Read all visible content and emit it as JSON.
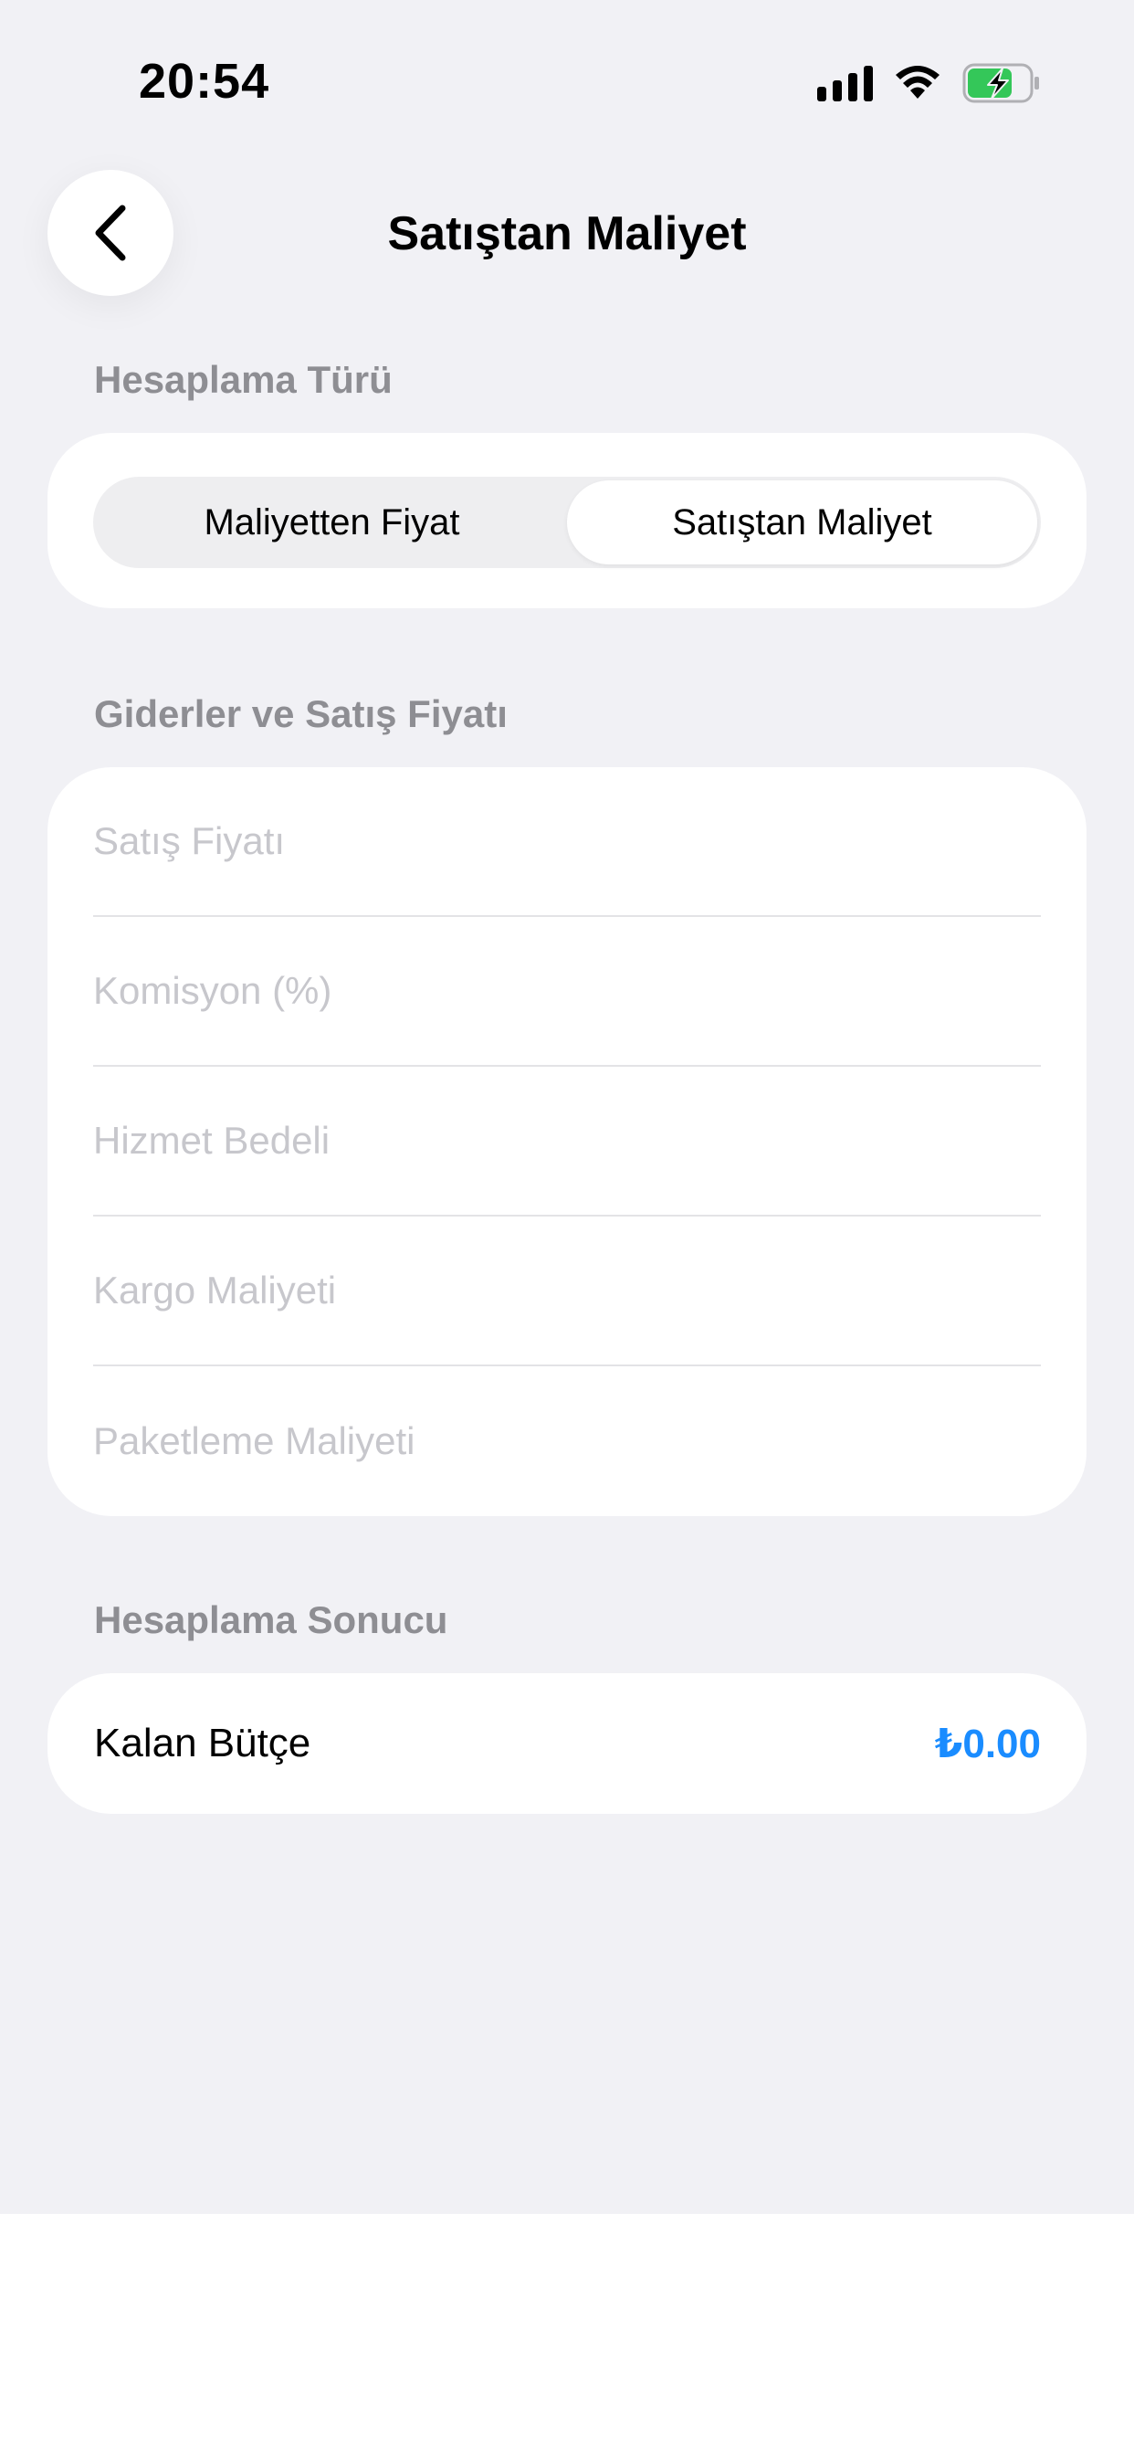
{
  "status_bar": {
    "time": "20:54"
  },
  "nav": {
    "title": "Satıştan Maliyet"
  },
  "calc_type": {
    "header": "Hesaplama Türü",
    "options": [
      "Maliyetten Fiyat",
      "Satıştan Maliyet"
    ],
    "selected": "Satıştan Maliyet"
  },
  "expenses": {
    "header": "Giderler ve Satış Fiyatı",
    "fields": [
      {
        "placeholder": "Satış Fiyatı",
        "value": ""
      },
      {
        "placeholder": "Komisyon (%)",
        "value": ""
      },
      {
        "placeholder": "Hizmet Bedeli",
        "value": ""
      },
      {
        "placeholder": "Kargo Maliyeti",
        "value": ""
      },
      {
        "placeholder": "Paketleme Maliyeti",
        "value": ""
      }
    ]
  },
  "result": {
    "header": "Hesaplama Sonucu",
    "label": "Kalan Bütçe",
    "value": "₺0.00"
  },
  "colors": {
    "background": "#f1f1f5",
    "accent": "#1a8cff",
    "battery": "#34c759",
    "section_header": "#8e8e93",
    "placeholder": "#c7c7cc"
  },
  "icons": {
    "signal": "cellular-signal-icon",
    "wifi": "wifi-icon",
    "battery": "battery-charging-icon",
    "back": "chevron-left-icon"
  }
}
